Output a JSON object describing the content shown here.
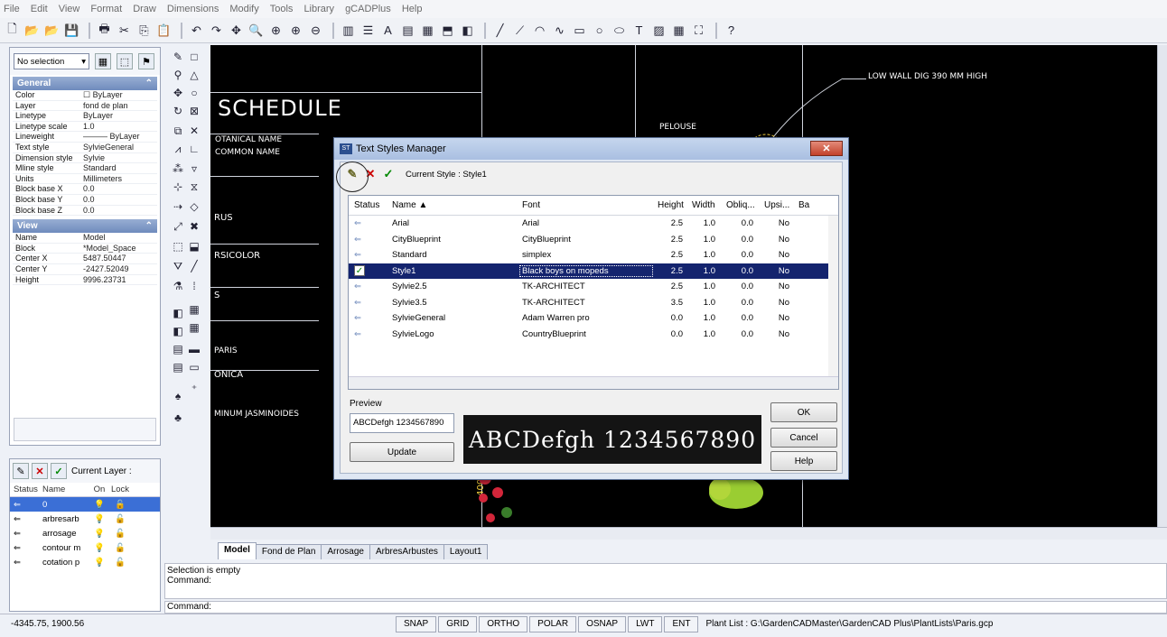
{
  "menu": [
    "File",
    "Edit",
    "View",
    "Format",
    "Draw",
    "Dimensions",
    "Modify",
    "Tools",
    "Library",
    "gCADPlus",
    "Help"
  ],
  "toolbar_icons": [
    "new-icon",
    "open-icon",
    "open-icon",
    "save-icon",
    "print-icon",
    "cut-icon",
    "copy-icon",
    "paste-icon",
    "undo-icon",
    "redo-icon",
    "pan-icon",
    "zoom-icon",
    "zoom-window-icon",
    "zoom-in-icon",
    "zoom-out-icon",
    "layers-icon",
    "properties-icon",
    "text-icon",
    "style-icon",
    "table-icon",
    "insert-icon",
    "block-icon",
    "line-icon",
    "polyline-icon",
    "arc-icon",
    "spline-icon",
    "rectangle-icon",
    "circle-icon",
    "ellipse-icon",
    "text-tool-icon",
    "hatch-icon",
    "grid-icon",
    "zoom-extents-icon",
    "help-icon"
  ],
  "left_panel": {
    "selection": "No selection",
    "general_title": "General",
    "general_rows": [
      {
        "k": "Color",
        "v": "☐ ByLayer"
      },
      {
        "k": "Layer",
        "v": "fond de plan"
      },
      {
        "k": "Linetype",
        "v": "ByLayer"
      },
      {
        "k": "Linetype scale",
        "v": "1.0"
      },
      {
        "k": "Lineweight",
        "v": "——— ByLayer"
      },
      {
        "k": "Text style",
        "v": "SylvieGeneral"
      },
      {
        "k": "Dimension style",
        "v": "Sylvie"
      },
      {
        "k": "Mline style",
        "v": "Standard"
      },
      {
        "k": "Units",
        "v": "Millimeters"
      },
      {
        "k": "Block base X",
        "v": "0.0"
      },
      {
        "k": "Block base Y",
        "v": "0.0"
      },
      {
        "k": "Block base Z",
        "v": "0.0"
      }
    ],
    "view_title": "View",
    "view_rows": [
      {
        "k": "Name",
        "v": "Model"
      },
      {
        "k": "Block",
        "v": "*Model_Space"
      },
      {
        "k": "Center X",
        "v": "5487.50447"
      },
      {
        "k": "Center Y",
        "v": "-2427.52049"
      },
      {
        "k": "Height",
        "v": "9996.23731"
      }
    ]
  },
  "layer_panel": {
    "current_label": "Current Layer :",
    "headers": [
      "Status",
      "Name",
      "On",
      "Lock"
    ],
    "rows": [
      {
        "name": "0",
        "sel": true
      },
      {
        "name": "arbresarb",
        "sel": false
      },
      {
        "name": "arrosage",
        "sel": false
      },
      {
        "name": "contour m",
        "sel": false
      },
      {
        "name": "cotation p",
        "sel": false
      }
    ]
  },
  "canvas_text": {
    "schedule": "SCHEDULE",
    "botanical": "OTANICAL NAME",
    "common": "COMMON NAME",
    "pelouse": "PELOUSE",
    "low_wall": "LOW WALL DIG 390 MM HIGH",
    "rus": "RUS",
    "versicolor": "RSICOLOR",
    "s": "S",
    "paris": "PARIS",
    "monica": "ONICA",
    "jasmin": "MINUM JASMINOIDES",
    "dim": "400.0"
  },
  "dialog": {
    "title": "Text Styles Manager",
    "current_style": "Current Style : Style1",
    "headers": {
      "status": "Status",
      "name": "Name ▲",
      "font": "Font",
      "height": "Height",
      "width": "Width",
      "oblique": "Obliq...",
      "upside": "Upsi...",
      "back": "Ba"
    },
    "rows": [
      {
        "name": "Arial",
        "font": "Arial",
        "height": "2.5",
        "width": "1.0",
        "oblique": "0.0",
        "upside": "No",
        "sel": false
      },
      {
        "name": "CityBlueprint",
        "font": "CityBlueprint",
        "height": "2.5",
        "width": "1.0",
        "oblique": "0.0",
        "upside": "No",
        "sel": false
      },
      {
        "name": "Standard",
        "font": "simplex",
        "height": "2.5",
        "width": "1.0",
        "oblique": "0.0",
        "upside": "No",
        "sel": false
      },
      {
        "name": "Style1",
        "font": "Black boys on mopeds",
        "height": "2.5",
        "width": "1.0",
        "oblique": "0.0",
        "upside": "No",
        "sel": true
      },
      {
        "name": "Sylvie2.5",
        "font": "TK-ARCHITECT",
        "height": "2.5",
        "width": "1.0",
        "oblique": "0.0",
        "upside": "No",
        "sel": false
      },
      {
        "name": "Sylvie3.5",
        "font": "TK-ARCHITECT",
        "height": "3.5",
        "width": "1.0",
        "oblique": "0.0",
        "upside": "No",
        "sel": false
      },
      {
        "name": "SylvieGeneral",
        "font": "Adam Warren pro",
        "height": "0.0",
        "width": "1.0",
        "oblique": "0.0",
        "upside": "No",
        "sel": false
      },
      {
        "name": "SylvieLogo",
        "font": "CountryBlueprint",
        "height": "0.0",
        "width": "1.0",
        "oblique": "0.0",
        "upside": "No",
        "sel": false
      }
    ],
    "preview_label": "Preview",
    "preview_text": "ABCDefgh 1234567890",
    "preview_image_text": "ABCDefgh 1234567890",
    "update": "Update",
    "ok": "OK",
    "cancel": "Cancel",
    "help": "Help"
  },
  "tabs": [
    "Model",
    "Fond de Plan",
    "Arrosage",
    "ArbresArbustes",
    "Layout1"
  ],
  "command": {
    "line1": "Selection is empty",
    "line2": "Command:",
    "prompt": "Command:"
  },
  "status": {
    "coords": "-4345.75, 1900.56",
    "buttons": [
      "SNAP",
      "GRID",
      "ORTHO",
      "POLAR",
      "OSNAP",
      "LWT",
      "ENT"
    ],
    "plant_list": "Plant List : G:\\GardenCADMaster\\GardenCAD Plus\\PlantLists\\Paris.gcp"
  }
}
